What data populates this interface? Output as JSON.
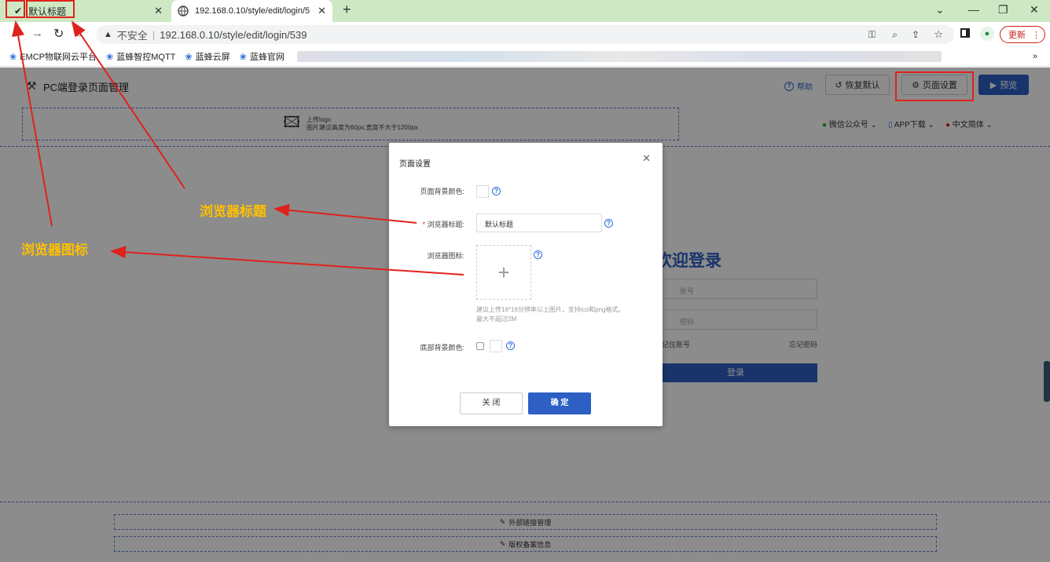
{
  "browser": {
    "tabs": [
      {
        "label": "默认标题",
        "icon": "favicon-icon"
      },
      {
        "label": "192.168.0.10/style/edit/login/5",
        "icon": "globe-icon"
      }
    ],
    "new_tab": "+",
    "address": {
      "insecure_label": "不安全",
      "url": "192.168.0.10/style/edit/login/539"
    },
    "update_label": "更新",
    "bookmarks": [
      "EMCP物联网云平台",
      "蓝蜂智控MQTT",
      "蓝蜂云屏",
      "蓝蜂官网"
    ],
    "bookmarks_more": "»"
  },
  "app": {
    "title": "PC端登录页面管理",
    "help_label": "帮助",
    "restore_label": "恢复默认",
    "page_settings_label": "页面设置",
    "preview_label": "预览",
    "logo_upload": {
      "title": "上传logo",
      "hint": "图片建议高度为60px,宽度不大于1200px"
    },
    "header_links": [
      "微信公众号",
      "APP下载",
      "中文简体"
    ],
    "login": {
      "title": "欢迎登录",
      "account_placeholder": "账号",
      "password_placeholder": "密码",
      "remember": "记住账号",
      "forgot": "忘记密码",
      "submit": "登录"
    },
    "footer_links": [
      "外部链接管理",
      "版权备案信息"
    ]
  },
  "modal": {
    "title": "页面设置",
    "bg_color_label": "页面背景颜色:",
    "browser_title_label": "浏览器标题:",
    "browser_title_required": "*",
    "browser_title_value": "默认标题",
    "browser_icon_label": "浏览器图标:",
    "upload_plus": "+",
    "icon_hint": "建议上传16*16分辨率以上图片，支持ico和png格式。最大不超过2M",
    "footer_bg_label": "底部背景颜色:",
    "close_label": "关 闭",
    "confirm_label": "确 定"
  },
  "annotations": {
    "browser_title_callout": "浏览器标题",
    "browser_icon_callout": "浏览器图标",
    "arrow_color": "#e0221c",
    "callout_color": "#ffc000"
  },
  "colors": {
    "primary": "#2d5fc4",
    "tabstrip": "#cde8c2"
  }
}
